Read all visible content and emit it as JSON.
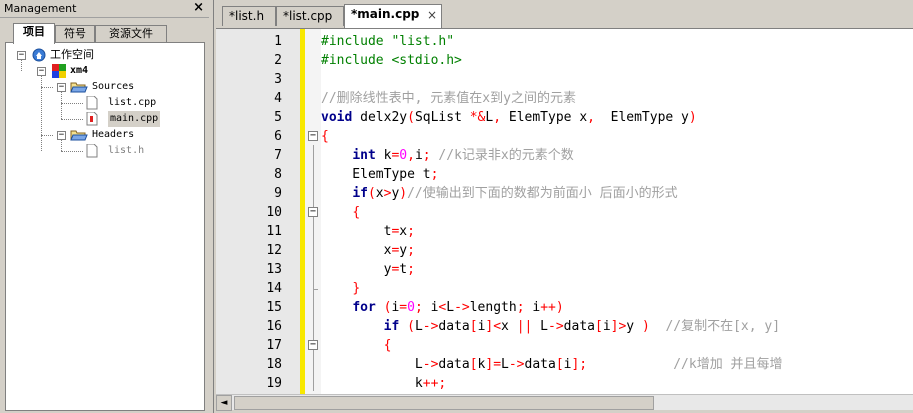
{
  "management": {
    "title": "Management",
    "close": "×",
    "tabs": [
      "项目",
      "符号",
      "资源文件"
    ],
    "tree": {
      "workspace": "工作空间",
      "project": "xm4",
      "sources_folder": "Sources",
      "sources": [
        "list.cpp",
        "main.cpp"
      ],
      "headers_folder": "Headers",
      "headers": [
        "list.h"
      ]
    }
  },
  "editor": {
    "tabs": [
      "*list.h",
      "*list.cpp",
      "*main.cpp"
    ],
    "tab_close": "×",
    "line_numbers": [
      "1",
      "2",
      "3",
      "4",
      "5",
      "6",
      "7",
      "8",
      "9",
      "10",
      "11",
      "12",
      "13",
      "14",
      "15",
      "16",
      "17",
      "18",
      "19"
    ],
    "lines": [
      [
        {
          "c": "pre",
          "t": "#include \"list.h\""
        }
      ],
      [
        {
          "c": "pre",
          "t": "#include <stdio.h>"
        }
      ],
      [],
      [
        {
          "c": "cm",
          "t": "//删除线性表中, 元素值在x到y之间的元素"
        }
      ],
      [
        {
          "c": "kw",
          "t": "void"
        },
        {
          "c": "",
          "t": " delx2y"
        },
        {
          "c": "op",
          "t": "("
        },
        {
          "c": "",
          "t": "SqList "
        },
        {
          "c": "op",
          "t": "*&"
        },
        {
          "c": "",
          "t": "L"
        },
        {
          "c": "op",
          "t": ","
        },
        {
          "c": "",
          "t": " ElemType x"
        },
        {
          "c": "op",
          "t": ","
        },
        {
          "c": "",
          "t": "  ElemType y"
        },
        {
          "c": "op",
          "t": ")"
        }
      ],
      [
        {
          "c": "op",
          "t": "{"
        }
      ],
      [
        {
          "c": "",
          "t": "    "
        },
        {
          "c": "kw",
          "t": "int"
        },
        {
          "c": "",
          "t": " k"
        },
        {
          "c": "op",
          "t": "="
        },
        {
          "c": "num",
          "t": "0"
        },
        {
          "c": "op",
          "t": ","
        },
        {
          "c": "",
          "t": "i"
        },
        {
          "c": "op",
          "t": ";"
        },
        {
          "c": "",
          "t": " "
        },
        {
          "c": "cm",
          "t": "//k记录非x的元素个数"
        }
      ],
      [
        {
          "c": "",
          "t": "    ElemType t"
        },
        {
          "c": "op",
          "t": ";"
        }
      ],
      [
        {
          "c": "",
          "t": "    "
        },
        {
          "c": "kw",
          "t": "if"
        },
        {
          "c": "op",
          "t": "("
        },
        {
          "c": "",
          "t": "x"
        },
        {
          "c": "op",
          "t": ">"
        },
        {
          "c": "",
          "t": "y"
        },
        {
          "c": "op",
          "t": ")"
        },
        {
          "c": "cm",
          "t": "//使输出到下面的数都为前面小 后面小的形式"
        }
      ],
      [
        {
          "c": "",
          "t": "    "
        },
        {
          "c": "op",
          "t": "{"
        }
      ],
      [
        {
          "c": "",
          "t": "        t"
        },
        {
          "c": "op",
          "t": "="
        },
        {
          "c": "",
          "t": "x"
        },
        {
          "c": "op",
          "t": ";"
        }
      ],
      [
        {
          "c": "",
          "t": "        x"
        },
        {
          "c": "op",
          "t": "="
        },
        {
          "c": "",
          "t": "y"
        },
        {
          "c": "op",
          "t": ";"
        }
      ],
      [
        {
          "c": "",
          "t": "        y"
        },
        {
          "c": "op",
          "t": "="
        },
        {
          "c": "",
          "t": "t"
        },
        {
          "c": "op",
          "t": ";"
        }
      ],
      [
        {
          "c": "",
          "t": "    "
        },
        {
          "c": "op",
          "t": "}"
        }
      ],
      [
        {
          "c": "",
          "t": "    "
        },
        {
          "c": "kw",
          "t": "for"
        },
        {
          "c": "",
          "t": " "
        },
        {
          "c": "op",
          "t": "("
        },
        {
          "c": "",
          "t": "i"
        },
        {
          "c": "op",
          "t": "="
        },
        {
          "c": "num",
          "t": "0"
        },
        {
          "c": "op",
          "t": ";"
        },
        {
          "c": "",
          "t": " i"
        },
        {
          "c": "op",
          "t": "<"
        },
        {
          "c": "",
          "t": "L"
        },
        {
          "c": "op",
          "t": "->"
        },
        {
          "c": "",
          "t": "length"
        },
        {
          "c": "op",
          "t": ";"
        },
        {
          "c": "",
          "t": " i"
        },
        {
          "c": "op",
          "t": "++)"
        }
      ],
      [
        {
          "c": "",
          "t": "        "
        },
        {
          "c": "kw",
          "t": "if"
        },
        {
          "c": "",
          "t": " "
        },
        {
          "c": "op",
          "t": "("
        },
        {
          "c": "",
          "t": "L"
        },
        {
          "c": "op",
          "t": "->"
        },
        {
          "c": "",
          "t": "data"
        },
        {
          "c": "op",
          "t": "["
        },
        {
          "c": "",
          "t": "i"
        },
        {
          "c": "op",
          "t": "]<"
        },
        {
          "c": "",
          "t": "x "
        },
        {
          "c": "op",
          "t": "||"
        },
        {
          "c": "",
          "t": " L"
        },
        {
          "c": "op",
          "t": "->"
        },
        {
          "c": "",
          "t": "data"
        },
        {
          "c": "op",
          "t": "["
        },
        {
          "c": "",
          "t": "i"
        },
        {
          "c": "op",
          "t": "]>"
        },
        {
          "c": "",
          "t": "y "
        },
        {
          "c": "op",
          "t": ")"
        },
        {
          "c": "",
          "t": "  "
        },
        {
          "c": "cm",
          "t": "//复制不在[x, y]"
        }
      ],
      [
        {
          "c": "",
          "t": "        "
        },
        {
          "c": "op",
          "t": "{"
        }
      ],
      [
        {
          "c": "",
          "t": "            L"
        },
        {
          "c": "op",
          "t": "->"
        },
        {
          "c": "",
          "t": "data"
        },
        {
          "c": "op",
          "t": "["
        },
        {
          "c": "",
          "t": "k"
        },
        {
          "c": "op",
          "t": "]="
        },
        {
          "c": "",
          "t": "L"
        },
        {
          "c": "op",
          "t": "->"
        },
        {
          "c": "",
          "t": "data"
        },
        {
          "c": "op",
          "t": "["
        },
        {
          "c": "",
          "t": "i"
        },
        {
          "c": "op",
          "t": "];"
        },
        {
          "c": "",
          "t": "           "
        },
        {
          "c": "cm",
          "t": "//k增加 并且每增"
        }
      ],
      [
        {
          "c": "",
          "t": "            k"
        },
        {
          "c": "op",
          "t": "++;"
        }
      ]
    ],
    "fold_markers": [
      "6",
      "10",
      "17"
    ],
    "fold_symbol": "−"
  },
  "scrollbar": {
    "left_arrow": "◄"
  }
}
